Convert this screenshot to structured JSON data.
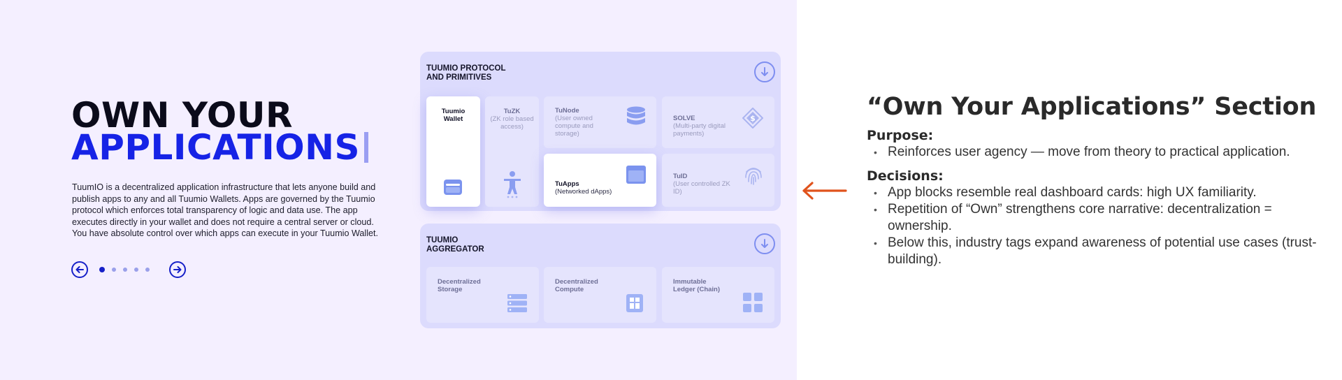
{
  "hero": {
    "title_line1": "OWN YOUR",
    "title_line2": "APPLICATIONS",
    "description": "TuumIO is a decentralized application infrastructure that lets anyone build and publish apps to any and all Tuumio Wallets. Apps are governed by the Tuumio protocol which enforces total transparency of logic and data use. The app executes directly in your wallet and does not require a central server or cloud. You have absolute control over which apps can execute in your Tuumio Wallet.",
    "pager": {
      "count": 5,
      "active_index": 0,
      "prev_icon": "arrow-left-circle-icon",
      "next_icon": "arrow-right-circle-icon"
    }
  },
  "protocol_panel": {
    "title_line1": "TUUMIO PROTOCOL",
    "title_line2": "AND PRIMITIVES",
    "tiles": {
      "wallet": {
        "name": "Tuumio",
        "name2": "Wallet",
        "icon": "wallet-icon"
      },
      "tuzk": {
        "name": "TuZK",
        "sub": "(ZK role based access)",
        "icon": "person-icon"
      },
      "tunode": {
        "name": "TuNode",
        "sub": "(User owned compute and storage)",
        "icon": "database-icon"
      },
      "solve": {
        "name": "SOLVE",
        "sub": "(Multi-party digital payments)",
        "icon": "dollar-diamond-icon"
      },
      "tuapps": {
        "name": "TuApps",
        "sub": "(Networked dApps)",
        "icon": "app-window-icon"
      },
      "tuid": {
        "name": "TuID",
        "sub": "(User controlled ZK ID)",
        "icon": "fingerprint-icon"
      }
    }
  },
  "aggregator_panel": {
    "title_line1": "TUUMIO",
    "title_line2": "AGGREGATOR",
    "tiles": {
      "storage": {
        "name": "Decentralized",
        "name2": "Storage",
        "icon": "server-icon"
      },
      "compute": {
        "name": "Decentralized",
        "name2": "Compute",
        "icon": "chip-icon"
      },
      "ledger": {
        "name": "Immutable",
        "name2": "Ledger (Chain)",
        "icon": "grid-blocks-icon"
      }
    }
  },
  "colors": {
    "accent": "#1623e6",
    "arrow": "#e0531c",
    "panel": "#dcdbfd",
    "left_bg": "#f4efff"
  },
  "notes": {
    "title": "“Own Your Applications” Section",
    "purpose_heading": "Purpose:",
    "purpose_items": [
      "Reinforces user agency — move from theory to practical application."
    ],
    "decisions_heading": "Decisions:",
    "decision_items": [
      "App blocks resemble real dashboard cards: high UX familiarity.",
      "Repetition of “Own” strengthens core narrative: decentralization = ownership.",
      "Below this, industry tags expand awareness of potential use cases (trust-building)."
    ]
  }
}
